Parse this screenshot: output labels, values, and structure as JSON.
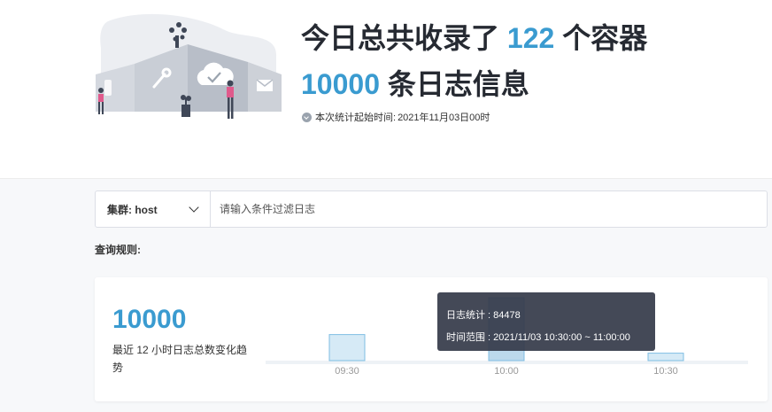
{
  "summary": {
    "line1_prefix": "今日总共收录了",
    "container_count": "122",
    "line1_suffix": "个容器",
    "log_count": "10000",
    "line2_suffix": "条日志信息",
    "since_label": "本次统计起始时间:",
    "since_value": "2021年11月03日00时"
  },
  "filter": {
    "cluster_label": "集群: host",
    "input_placeholder": "请输入条件过滤日志",
    "input_value": ""
  },
  "rules_label": "查询规则:",
  "trend_card": {
    "total": "10000",
    "description": "最近 12 小时日志总数变化趋势"
  },
  "chart_data": {
    "type": "bar",
    "categories": [
      "09:30",
      "10:00",
      "10:30"
    ],
    "x_tick_labels": [
      "09:30",
      "10:00",
      "10:30"
    ],
    "values": [
      35000,
      84478,
      10000
    ],
    "ylim": [
      0,
      100000
    ],
    "grid": false,
    "highlighted_index": 1,
    "colors": {
      "bar_fill": "#d6eaf6",
      "bar_stroke": "#7fbde3",
      "bar_highlight": "#89c4e6",
      "baseline": "#eef2f6",
      "tick": "#999999"
    }
  },
  "tooltip": {
    "line1": "日志统计 : 84478",
    "line2": "时间范围 : 2021/11/03 10:30:00 ~ 11:00:00"
  },
  "icons": [
    "clock-icon",
    "chevron-down-icon",
    "wrench-icon",
    "cloud-check-icon",
    "mail-icon",
    "plant-icon"
  ],
  "colors": {
    "accent": "#3a9bd0",
    "heading": "#262a32"
  }
}
